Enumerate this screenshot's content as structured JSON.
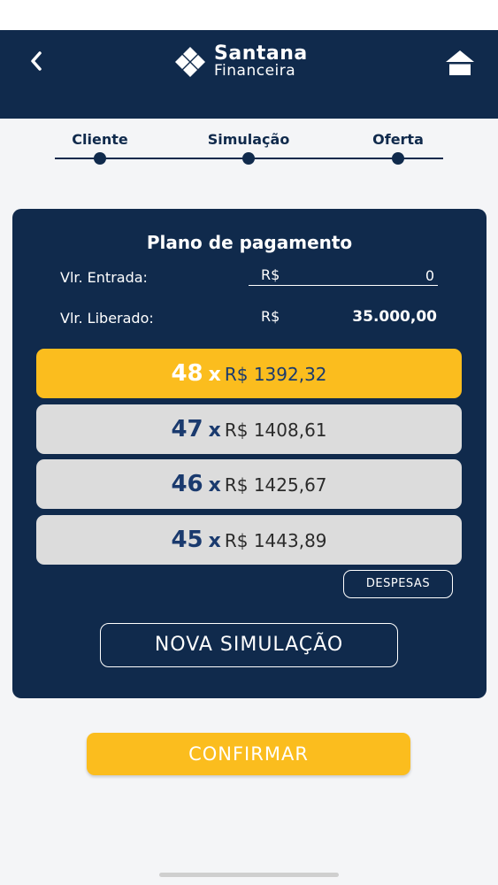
{
  "header": {
    "brand_name": "Santana",
    "brand_sub": "Financeira"
  },
  "steps": [
    "Cliente",
    "Simulação",
    "Oferta"
  ],
  "plan": {
    "title": "Plano de pagamento",
    "entrada_label": "Vlr. Entrada:",
    "entrada_currency": "R$",
    "entrada_value": "0",
    "liberado_label": "Vlr. Liberado:",
    "liberado_currency": "R$",
    "liberado_value": "35.000,00",
    "options": [
      {
        "count": "48",
        "x": "x",
        "amount": "R$ 1392,32"
      },
      {
        "count": "47",
        "x": "x",
        "amount": "R$ 1408,61"
      },
      {
        "count": "46",
        "x": "x",
        "amount": "R$ 1425,67"
      },
      {
        "count": "45",
        "x": "x",
        "amount": "R$ 1443,89"
      }
    ],
    "selected_option": "48",
    "despesas_label": "DESPESAS",
    "nova_label": "NOVA SIMULAÇÃO"
  },
  "confirm_label": "CONFIRMAR",
  "colors": {
    "navy": "#102a4c",
    "accent": "#fbbd1e",
    "option_bg": "#dcdcdc",
    "background": "#f4f5f7"
  },
  "icons": {
    "back": "chevron-left-icon",
    "home": "home-icon",
    "logo": "diamond-logo-icon"
  }
}
